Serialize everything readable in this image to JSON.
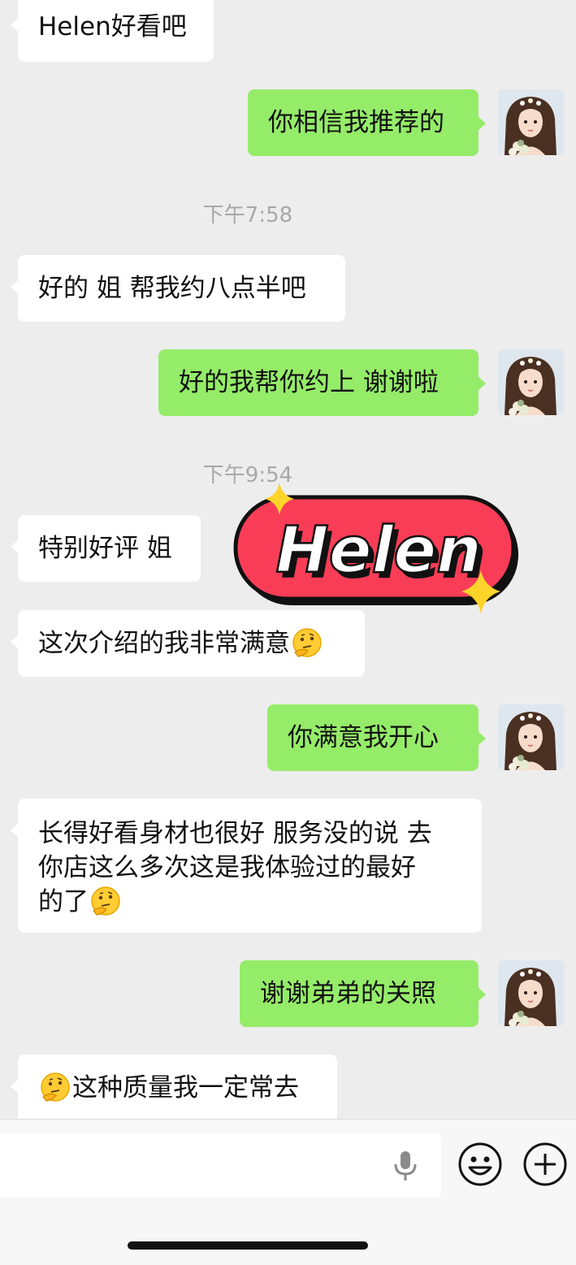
{
  "messages": [
    {
      "text": "Helen好看吧"
    },
    {
      "text": "你相信我推荐的"
    },
    {
      "text": "好的 姐 帮我约八点半吧"
    },
    {
      "text": "好的我帮你约上 谢谢啦"
    },
    {
      "text": "特别好评 姐"
    },
    {
      "text": "这次介绍的我非常满意"
    },
    {
      "text": "你满意我开心"
    },
    {
      "line1": "长得好看身材也很好 服务没的说 去",
      "line2": "你店这么多次这是我体验过的最好",
      "line3": "的了"
    },
    {
      "text": "谢谢弟弟的关照"
    },
    {
      "text": "这种质量我一定常去"
    }
  ],
  "timestamps": [
    "下午7:58",
    "下午9:54"
  ],
  "sticker": {
    "text": "Helen",
    "color": "#f93d57"
  },
  "colors": {
    "outgoing": "#95ec69",
    "incoming": "#ffffff",
    "background": "#ededed"
  },
  "icons": [
    "microphone-icon",
    "emoji-face-icon",
    "plus-circle-icon",
    "thinking-face-emoji"
  ]
}
